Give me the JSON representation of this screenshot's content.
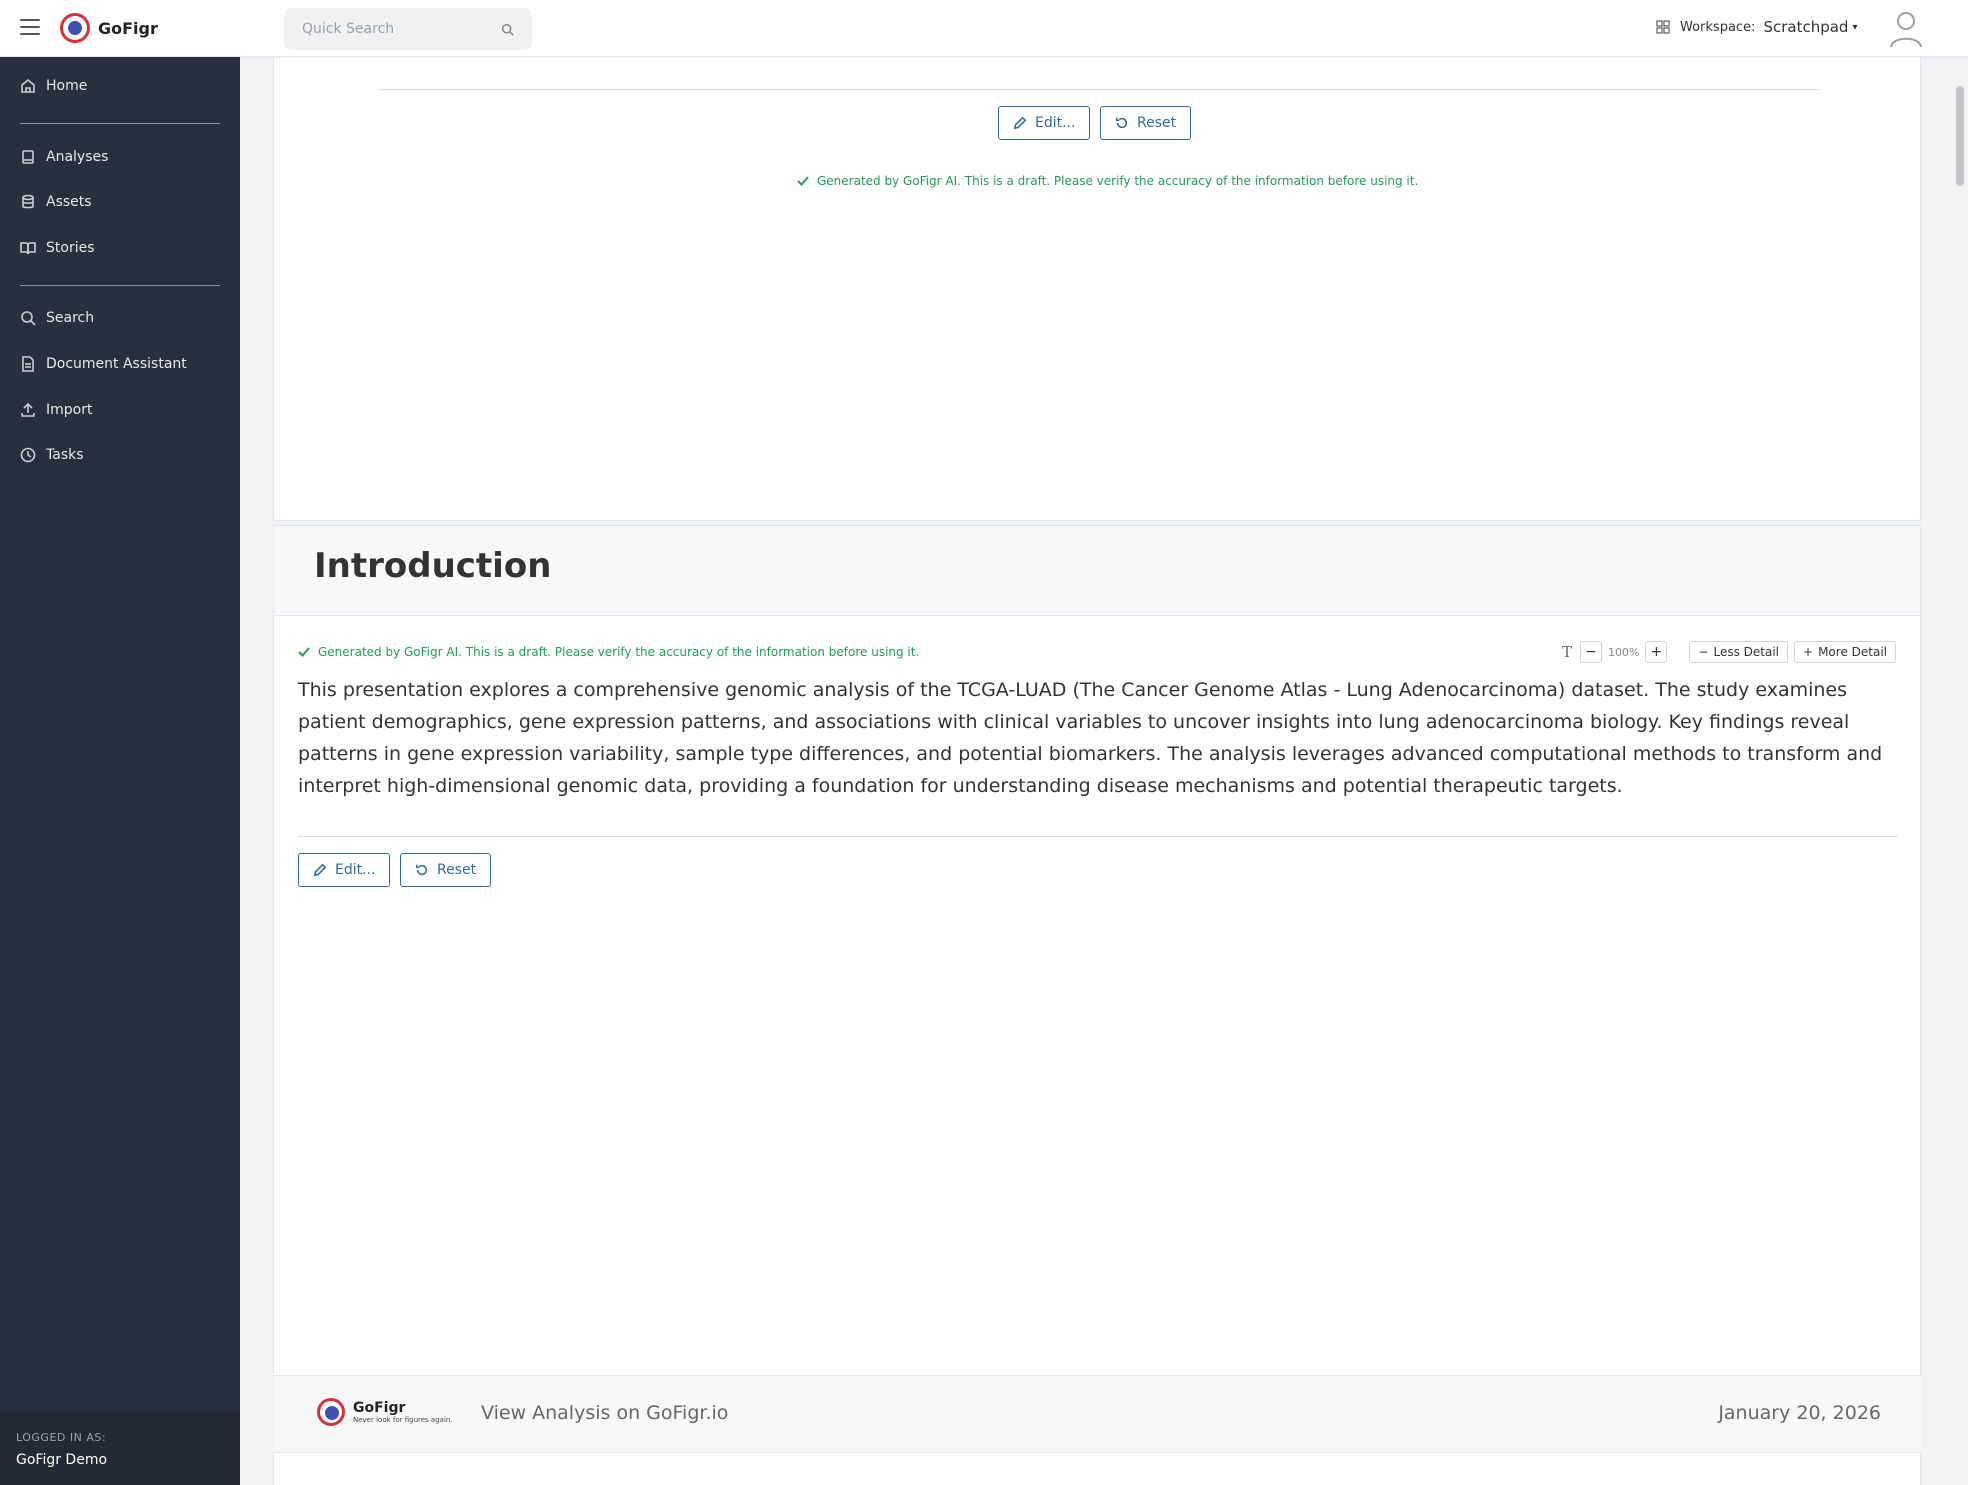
{
  "header": {
    "app_name": "GoFigr",
    "search_placeholder": "Quick Search",
    "workspace_label": "Workspace:",
    "workspace_value": "Scratchpad"
  },
  "sidebar": {
    "items": [
      {
        "label": "Home",
        "icon": "home-icon"
      },
      {
        "label": "Analyses",
        "icon": "notebook-icon"
      },
      {
        "label": "Assets",
        "icon": "database-icon"
      },
      {
        "label": "Stories",
        "icon": "book-open-icon"
      },
      {
        "label": "Search",
        "icon": "search-icon"
      },
      {
        "label": "Document Assistant",
        "icon": "document-icon"
      },
      {
        "label": "Import",
        "icon": "upload-icon"
      },
      {
        "label": "Tasks",
        "icon": "clock-icon"
      }
    ],
    "logged_in_label": "LOGGED IN AS:",
    "logged_in_user": "GoFigr Demo"
  },
  "top_section": {
    "edit_label": "Edit...",
    "reset_label": "Reset",
    "ai_note": "Generated by GoFigr AI. This is a draft. Please verify the accuracy of the information before using it."
  },
  "intro_section": {
    "title": "Introduction",
    "ai_note": "Generated by GoFigr AI. This is a draft. Please verify the accuracy of the information before using it.",
    "zoom": "100%",
    "less_detail": "Less Detail",
    "more_detail": "More Detail",
    "body": "This presentation explores a comprehensive genomic analysis of the TCGA-LUAD (The Cancer Genome Atlas - Lung Adenocarcinoma) dataset. The study examines patient demographics, gene expression patterns, and associations with clinical variables to uncover insights into lung adenocarcinoma biology. Key findings reveal patterns in gene expression variability, sample type differences, and potential biomarkers. The analysis leverages advanced computational methods to transform and interpret high-dimensional genomic data, providing a foundation for understanding disease mechanisms and potential therapeutic targets.",
    "edit_label": "Edit...",
    "reset_label": "Reset"
  },
  "footer": {
    "brand": "GoFigr",
    "tagline": "Never look for figures again.",
    "link": "View Analysis on GoFigr.io",
    "date": "January 20, 2026"
  },
  "colors": {
    "sidebar_bg": "#27303f",
    "accent": "#2f6b9a",
    "ai_note": "#1f9d55"
  }
}
